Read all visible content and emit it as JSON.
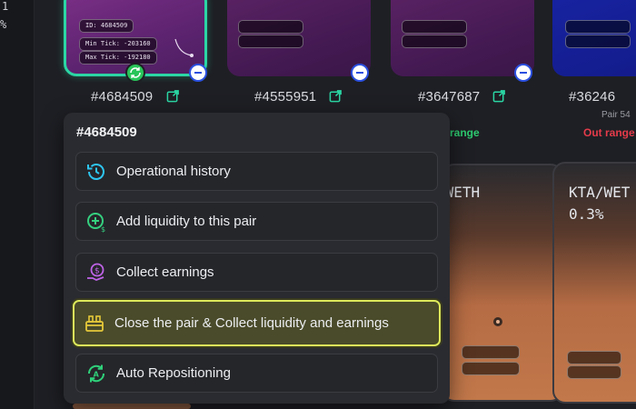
{
  "sidebar": {
    "line1": "1",
    "line2": "%"
  },
  "cards": [
    {
      "id_label": "#4684509",
      "pills": [
        "ID: 4684509",
        "Min Tick: -203160",
        "Max Tick: -192180"
      ],
      "status": ""
    },
    {
      "id_label": "#4555951",
      "status": ""
    },
    {
      "id_label": "#3647687",
      "status": "range"
    },
    {
      "id_label": "#36246",
      "status_top": "Pair 54",
      "status": "Out range"
    }
  ],
  "lower_cards": [
    {
      "title": "/WETH"
    },
    {
      "title": "KTA/WET",
      "subtitle": "0.3%"
    }
  ],
  "menu": {
    "title": "#4684509",
    "items": [
      {
        "label": "Operational history",
        "icon": "history-icon"
      },
      {
        "label": "Add liquidity to this pair",
        "icon": "add-liquidity-icon"
      },
      {
        "label": "Collect earnings",
        "icon": "collect-earnings-icon"
      },
      {
        "label": "Close the pair & Collect liquidity and earnings",
        "icon": "close-pair-icon"
      },
      {
        "label": "Auto Repositioning",
        "icon": "auto-reposition-icon"
      }
    ]
  },
  "colors": {
    "accent_green": "#2bd6a4",
    "highlight": "#dde95a",
    "status_red": "#e53b4a",
    "status_green": "#2ecc71"
  }
}
